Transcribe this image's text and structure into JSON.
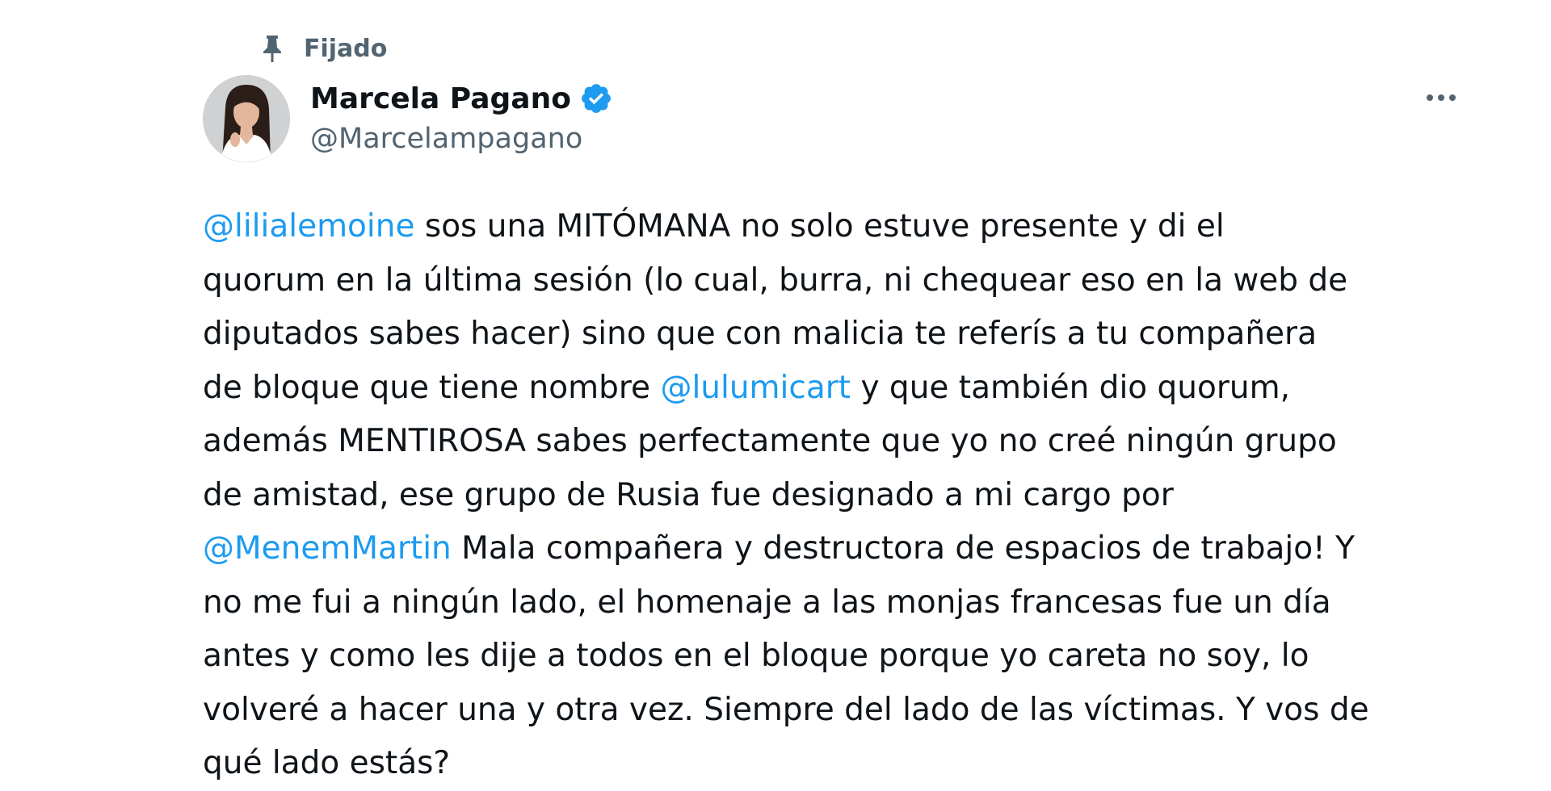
{
  "pinned": {
    "label": "Fijado",
    "icon": "pin-icon"
  },
  "author": {
    "display_name": "Marcela Pagano",
    "handle": "@Marcelampagano",
    "verified": true,
    "verified_icon": "verified-badge-icon",
    "avatar": "avatar-photo"
  },
  "more_icon": "more-dots-icon",
  "colors": {
    "text": "#0f1419",
    "secondary": "#536471",
    "link": "#1d9bf0",
    "verified": "#1d9bf0"
  },
  "tweet": {
    "lines": [
      [
        {
          "t": "@lilialemoine",
          "m": true
        },
        {
          "t": " sos una MITÓMANA no solo estuve presente y di el"
        }
      ],
      [
        {
          "t": "quorum en la última sesión (lo cual, burra, ni chequear eso en la web de"
        }
      ],
      [
        {
          "t": "diputados sabes hacer) sino que con malicia te referís a tu compañera"
        }
      ],
      [
        {
          "t": "de bloque que tiene nombre "
        },
        {
          "t": "@lulumicart",
          "m": true
        },
        {
          "t": " y que también dio quorum,"
        }
      ],
      [
        {
          "t": "además MENTIROSA sabes perfectamente que yo no creé ningún grupo"
        }
      ],
      [
        {
          "t": "de amistad, ese grupo de Rusia fue designado a mi cargo por"
        }
      ],
      [
        {
          "t": "@MenemMartin",
          "m": true
        },
        {
          "t": " Mala compañera y destructora de espacios de trabajo! Y"
        }
      ],
      [
        {
          "t": "no me fui a ningún lado, el homenaje a las monjas francesas fue un día"
        }
      ],
      [
        {
          "t": "antes y como les dije a todos en el bloque porque yo careta no soy, lo"
        }
      ],
      [
        {
          "t": "volveré a hacer una y otra vez. Siempre del lado de las víctimas. Y vos de"
        }
      ],
      [
        {
          "t": "qué lado estás?"
        }
      ]
    ]
  }
}
